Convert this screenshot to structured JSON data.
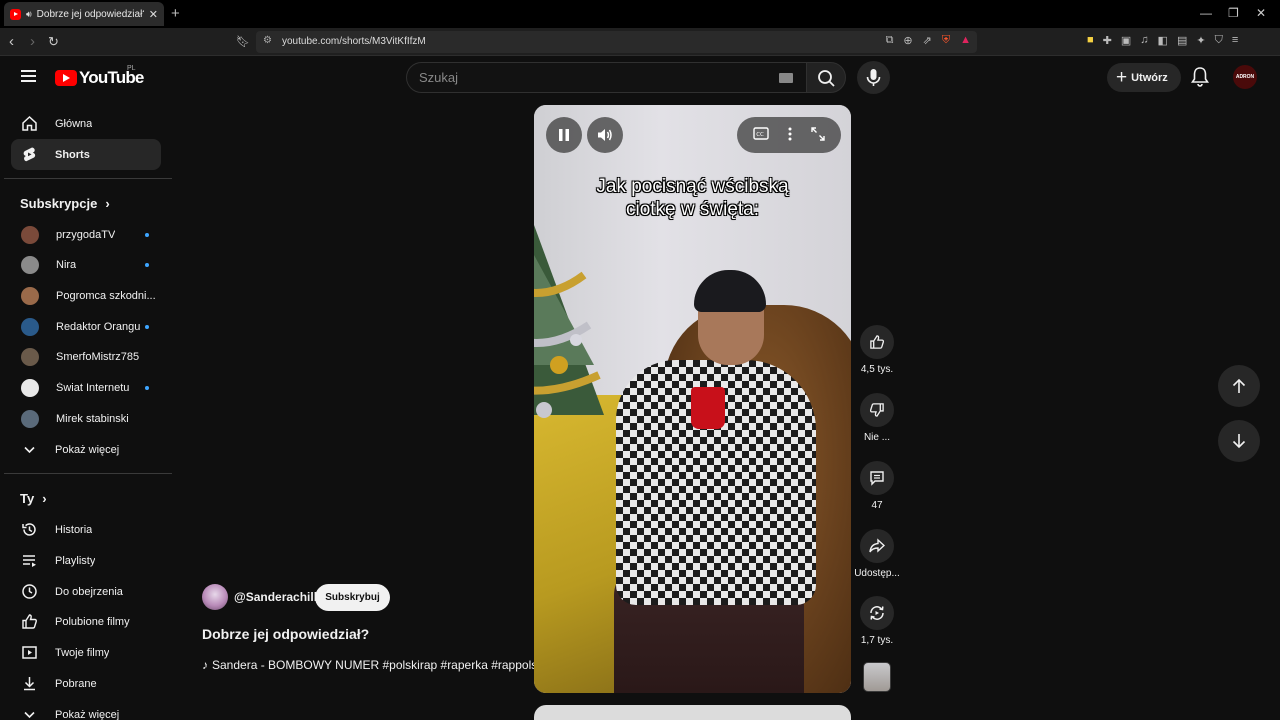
{
  "browser": {
    "tab_title": "Dobrze jej odpowiedział? - Yo",
    "tab_close": "✕",
    "new_tab": "+",
    "url": "youtube.com/shorts/M3VitKfIfzM",
    "window_controls": [
      "—",
      "❐",
      "✕"
    ]
  },
  "header": {
    "logo_text": "YouTube",
    "logo_region": "PL",
    "search_placeholder": "Szukaj",
    "create_label": "Utwórz",
    "avatar_text": "ADRON"
  },
  "sidebar": {
    "main": [
      {
        "label": "Główna",
        "icon": "home-icon"
      },
      {
        "label": "Shorts",
        "icon": "shorts-icon",
        "active": true
      }
    ],
    "subscriptions_heading": "Subskrypcje",
    "subscriptions": [
      {
        "label": "przygodaTV",
        "color": "#7a4a3a",
        "new": true
      },
      {
        "label": "Nira",
        "color": "#8a8a8a",
        "new": true
      },
      {
        "label": "Pogromca szkodni...",
        "color": "#9a6a4a",
        "new": false
      },
      {
        "label": "Redaktor Orangu...",
        "color": "#2a5a8a",
        "new": true
      },
      {
        "label": "SmerfoMistrz785",
        "color": "#6a5a4a",
        "new": false
      },
      {
        "label": "Świat Internetu",
        "color": "#e8e8e8",
        "new": true
      },
      {
        "label": "Mirek stabinski",
        "color": "#5a6a7a",
        "new": false
      }
    ],
    "show_more": "Pokaż więcej",
    "you_heading": "Ty",
    "you_items": [
      {
        "label": "Historia",
        "icon": "history-icon"
      },
      {
        "label": "Playlisty",
        "icon": "playlist-icon"
      },
      {
        "label": "Do obejrzenia",
        "icon": "watch-later-icon"
      },
      {
        "label": "Polubione filmy",
        "icon": "like-icon"
      },
      {
        "label": "Twoje filmy",
        "icon": "your-videos-icon"
      },
      {
        "label": "Pobrane",
        "icon": "download-icon"
      }
    ],
    "show_more_2": "Pokaż więcej"
  },
  "short": {
    "caption_line1": "Jak pocisnąć wścibską",
    "caption_line2": "ciotkę w święta:",
    "channel_handle": "@Sanderachill",
    "subscribe_label": "Subskrybuj",
    "title": "Dobrze jej odpowiedział?",
    "music": "Sandera - BOMBOWY NUMER #polskirap #raperka #rappols"
  },
  "actions": {
    "likes": "4,5 tys.",
    "dislike": "Nie ...",
    "comments": "47",
    "share": "Udostęp...",
    "remix": "1,7 tys."
  }
}
